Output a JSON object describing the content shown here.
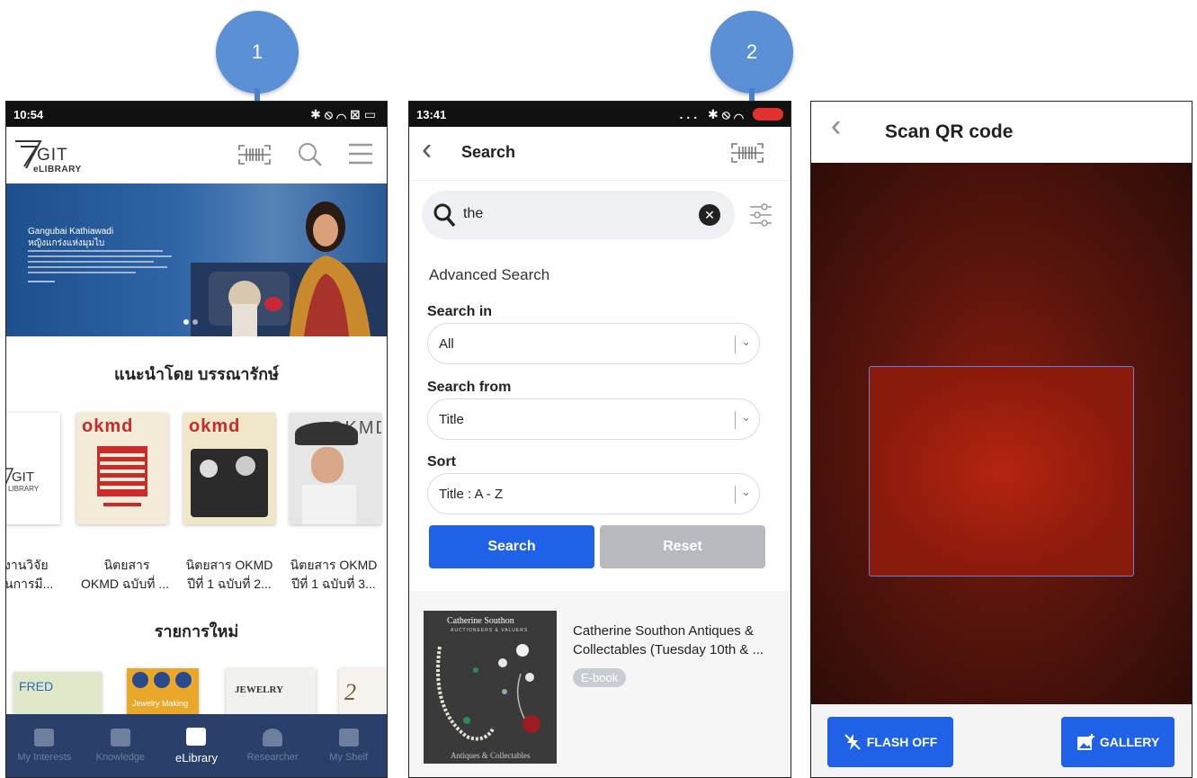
{
  "steps": {
    "one": "1",
    "two": "2"
  },
  "screen1": {
    "time": "10:54",
    "status_icons": "✱⦸⌒⊠▭",
    "logo": {
      "brand": "GIT",
      "sub": "eLIBRARY"
    },
    "header_icons": [
      "barcode-scan-icon",
      "search-icon",
      "menu-icon"
    ],
    "banner": {
      "title_line1": "Gangubai Kathiawadi",
      "title_line2": "หญิงแกร่งแห่งมุมไบ"
    },
    "recommended_title": "แนะนำโดย บรรณารักษ์",
    "recommended": [
      {
        "line1": "งานวิจัย",
        "line2": "ันการมี..."
      },
      {
        "line1": "นิตยสาร",
        "line2": "OKMD ฉบับที่ ..."
      },
      {
        "line1": "นิตยสาร OKMD",
        "line2": "ปีที่ 1 ฉบับที่ 2..."
      },
      {
        "line1": "นิตยสาร OKMD",
        "line2": "ปีที่ 1 ฉบับที่ 3..."
      }
    ],
    "covers": {
      "git": "GIT",
      "git_sub": "LIBRARY",
      "okmd": "okmd",
      "okmd_caps": "OKMD",
      "jewelry": "JEWELRY",
      "jewelry_making": "Jewelry Making",
      "fred": "FRED"
    },
    "new_title": "รายการใหม่",
    "nav": [
      "My Interests",
      "Knowledge",
      "eLibrary",
      "Researcher",
      "My Shelf"
    ]
  },
  "screen2": {
    "time": "13:41",
    "status_icons": "... ✱⦸⌒",
    "title": "Search",
    "query": "the",
    "advanced_label": "Advanced Search",
    "search_in_label": "Search in",
    "search_in_value": "All",
    "search_from_label": "Search from",
    "search_from_value": "Title",
    "sort_label": "Sort",
    "sort_value": "Title : A - Z",
    "search_button": "Search",
    "reset_button": "Reset",
    "result": {
      "cover_brand": "Catherine Southon",
      "cover_sub": "AUCTIONEERS & VALUERS",
      "cover_footer": "Antiques & Collectables",
      "title_line1": "Catherine Southon Antiques &",
      "title_line2": "Collectables (Tuesday 10th & ...",
      "badge": "E-book"
    }
  },
  "screen3": {
    "title": "Scan QR code",
    "flash_button": "FLASH OFF",
    "gallery_button": "GALLERY"
  },
  "colors": {
    "primary_blue": "#1f62e8",
    "nav_bg": "#2a3f6a",
    "callout": "#5b8fd6"
  }
}
